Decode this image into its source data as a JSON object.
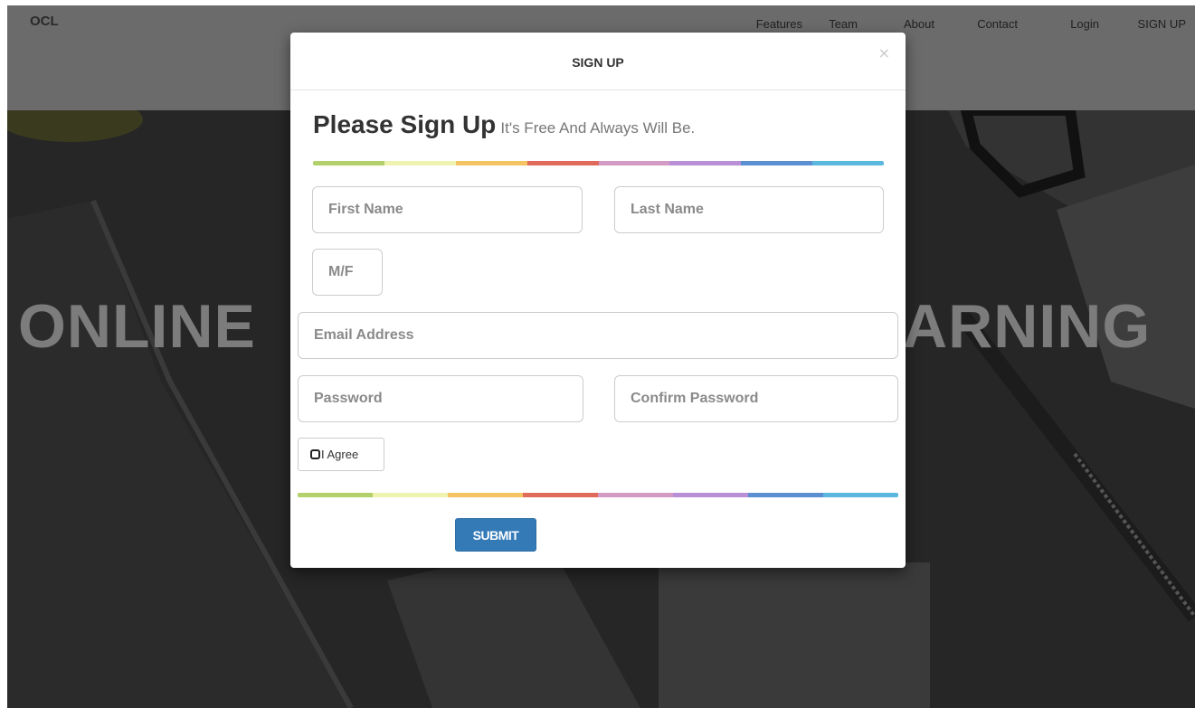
{
  "navbar": {
    "brand": "OCL",
    "links": [
      "Features",
      "Team",
      "About",
      "Contact",
      "Login",
      "SIGN UP"
    ]
  },
  "hero": {
    "title_left": "ONLINE",
    "title_right": "ARNING"
  },
  "modal": {
    "title": "SIGN UP",
    "close": "×",
    "heading_main": "Please Sign Up",
    "heading_sub": "It's Free And Always Will Be.",
    "fields": {
      "first_name": "First Name",
      "last_name": "Last Name",
      "gender": "M/F",
      "email": "Email Address",
      "password": "Password",
      "confirm_password": "Confirm Password"
    },
    "agree_label": "I Agree",
    "submit_label": "SUBMIT"
  },
  "colors": {
    "rainbow": [
      "#b2d16a",
      "#eef3b0",
      "#f5c462",
      "#e06b5b",
      "#d39ac4",
      "#b98fd6",
      "#5c8fd2",
      "#5ab7de"
    ],
    "primary_button": "#337ab7"
  }
}
